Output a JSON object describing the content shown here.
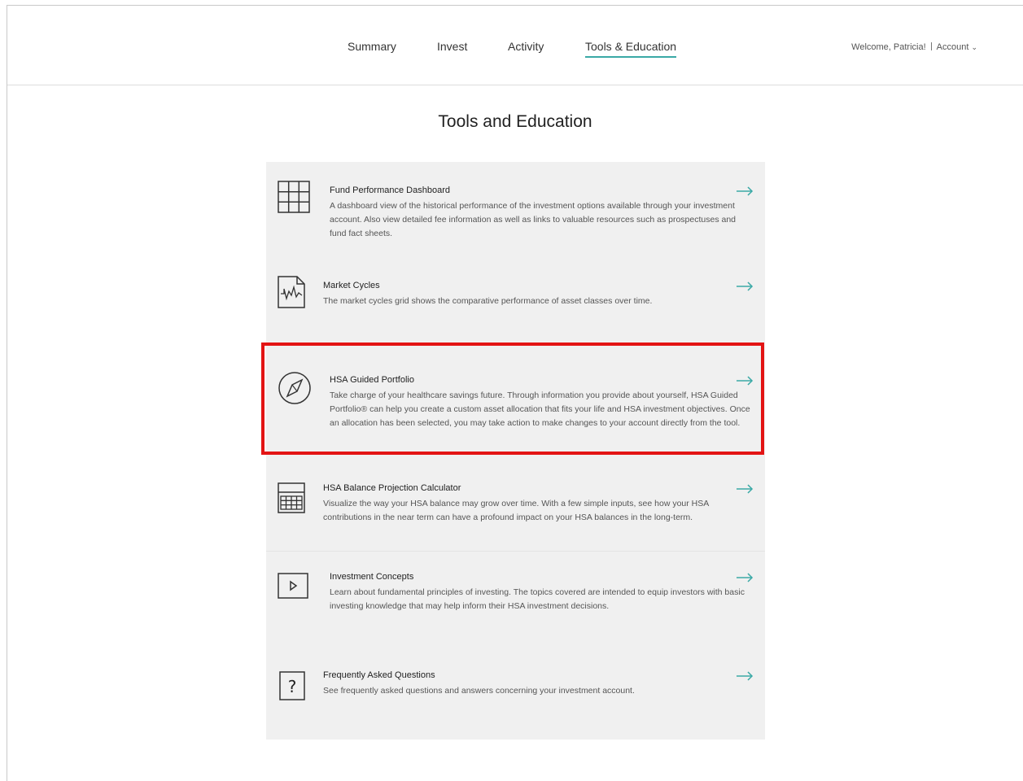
{
  "nav": {
    "items": [
      "Summary",
      "Invest",
      "Activity",
      "Tools & Education"
    ],
    "active": "Tools & Education",
    "welcome": "Welcome, Patricia!",
    "account": "Account"
  },
  "page": {
    "title": "Tools and Education"
  },
  "tools": [
    {
      "title": "Fund Performance Dashboard",
      "description": "A dashboard view of the historical performance of the investment options available through your investment account. Also view detailed fee information as well as links to valuable resources such as prospectuses and fund fact sheets.",
      "icon": "grid-icon"
    },
    {
      "title": "Market Cycles",
      "description": "The market cycles grid shows the comparative performance of asset classes over time.",
      "icon": "chart-document-icon"
    },
    {
      "title": "HSA Guided Portfolio",
      "description": "Take charge of your healthcare savings future. Through information you provide about yourself, HSA Guided Portfolio® can help you create a custom asset allocation that fits your life and HSA investment objectives. Once an allocation has been selected, you may take action to make changes to your account directly from the tool.",
      "icon": "compass-icon"
    },
    {
      "title": "HSA Balance Projection Calculator",
      "description": "Visualize the way your HSA balance may grow over time. With a few simple inputs, see how your HSA contributions in the near term can have a profound impact on your HSA balances in the long-term.",
      "icon": "calculator-icon"
    },
    {
      "title": "Investment Concepts",
      "description": "Learn about fundamental principles of investing. The topics covered are intended to equip investors with basic investing knowledge that may help inform their HSA investment decisions.",
      "icon": "play-icon"
    },
    {
      "title": "Frequently Asked Questions",
      "description": "See frequently asked questions and answers concerning your investment account.",
      "icon": "question-icon"
    }
  ],
  "colors": {
    "accent": "#3aa9a6",
    "highlight": "#e31414",
    "panel": "#f0f0f0"
  }
}
